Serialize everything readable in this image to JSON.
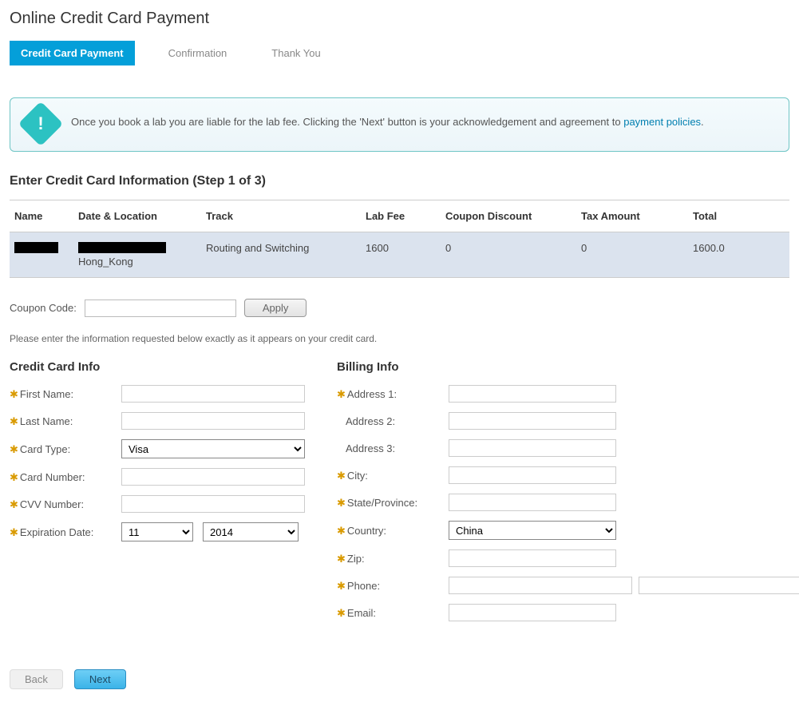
{
  "page_title": "Online Credit Card Payment",
  "tabs": {
    "credit_card": "Credit Card Payment",
    "confirmation": "Confirmation",
    "thank_you": "Thank You"
  },
  "info": {
    "text_prefix": "Once you book a lab you are liable for the lab fee. Clicking the 'Next' button is your acknowledgement and agreement to ",
    "link_text": "payment policies",
    "text_suffix": "."
  },
  "step_heading": "Enter Credit Card Information (Step 1 of 3)",
  "summary": {
    "headers": {
      "name": "Name",
      "date_location": "Date & Location",
      "track": "Track",
      "lab_fee": "Lab Fee",
      "coupon_discount": "Coupon Discount",
      "tax_amount": "Tax Amount",
      "total": "Total"
    },
    "row": {
      "location": "Hong_Kong",
      "track": "Routing and Switching",
      "lab_fee": "1600",
      "coupon_discount": "0",
      "tax_amount": "0",
      "total": "1600.0"
    }
  },
  "coupon": {
    "label": "Coupon Code:",
    "apply": "Apply"
  },
  "hint": "Please enter the information requested below exactly as it appears on your credit card.",
  "cc": {
    "heading": "Credit Card Info",
    "first_name": "First Name:",
    "last_name": "Last Name:",
    "card_type": "Card Type:",
    "card_type_value": "Visa",
    "card_number": "Card Number:",
    "cvv": "CVV Number:",
    "expiration": "Expiration Date:",
    "exp_month": "11",
    "exp_year": "2014"
  },
  "billing": {
    "heading": "Billing Info",
    "address1": "Address 1:",
    "address2": "Address 2:",
    "address3": "Address 3:",
    "city": "City:",
    "state": "State/Province:",
    "country": "Country:",
    "country_value": "China",
    "zip": "Zip:",
    "phone": "Phone:",
    "email": "Email:"
  },
  "buttons": {
    "back": "Back",
    "next": "Next"
  }
}
